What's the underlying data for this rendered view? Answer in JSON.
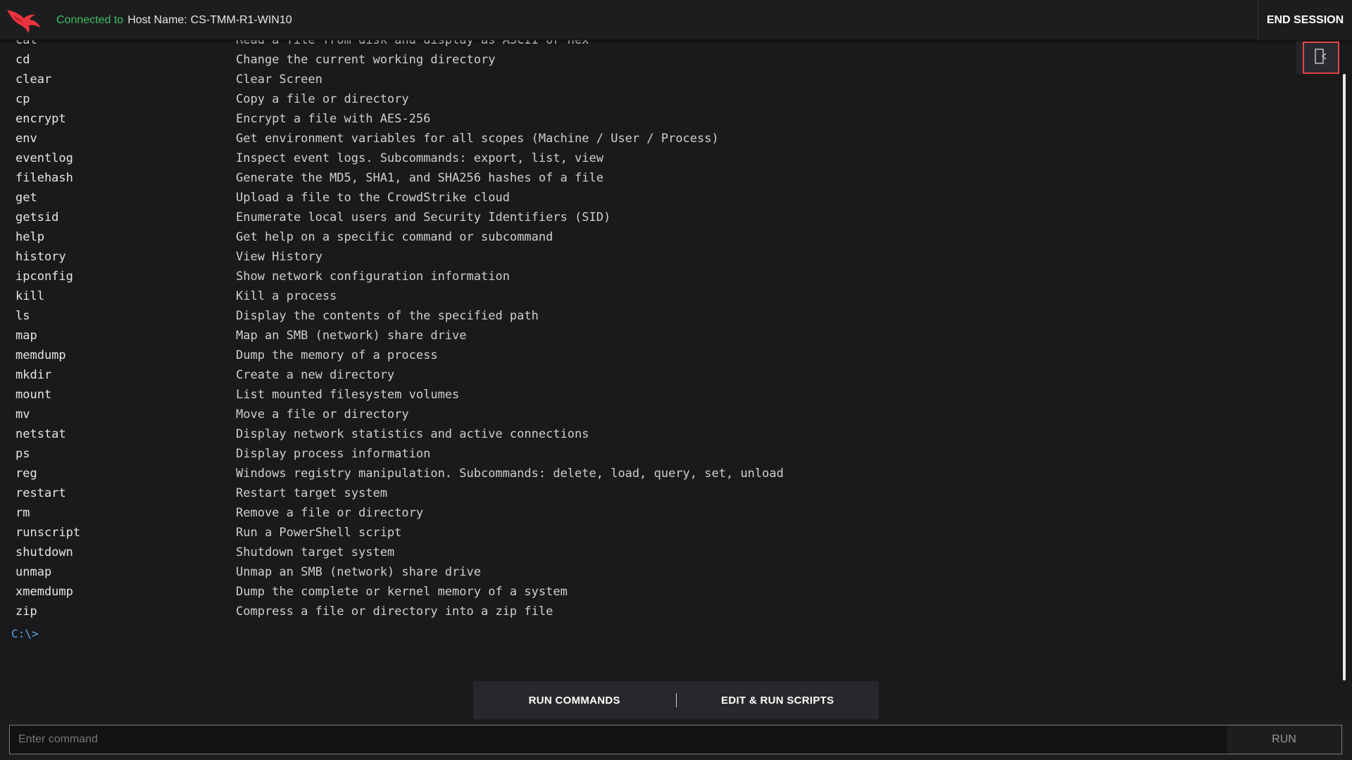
{
  "header": {
    "connected_label": "Connected to",
    "host_label": "Host Name:",
    "host_value": "CS-TMM-R1-WIN10",
    "end_session": "END SESSION"
  },
  "icons": {
    "logo": "falcon-logo-icon",
    "side_panel": "panel-toggle-icon"
  },
  "colors": {
    "connected": "#3fbf5e",
    "prompt": "#5aa6ea",
    "highlight_border": "#e04545"
  },
  "terminal": {
    "commands": [
      {
        "name": "cat",
        "desc": "Read a file from disk and display as ASCII or hex"
      },
      {
        "name": "cd",
        "desc": "Change the current working directory"
      },
      {
        "name": "clear",
        "desc": "Clear Screen"
      },
      {
        "name": "cp",
        "desc": "Copy a file or directory"
      },
      {
        "name": "encrypt",
        "desc": "Encrypt a file with AES-256"
      },
      {
        "name": "env",
        "desc": "Get environment variables for all scopes (Machine / User / Process)"
      },
      {
        "name": "eventlog",
        "desc": "Inspect event logs. Subcommands: export, list, view"
      },
      {
        "name": "filehash",
        "desc": "Generate the MD5, SHA1, and SHA256 hashes of a file"
      },
      {
        "name": "get",
        "desc": "Upload a file to the CrowdStrike cloud"
      },
      {
        "name": "getsid",
        "desc": "Enumerate local users and Security Identifiers (SID)"
      },
      {
        "name": "help",
        "desc": "Get help on a specific command or subcommand"
      },
      {
        "name": "history",
        "desc": "View History"
      },
      {
        "name": "ipconfig",
        "desc": "Show network configuration information"
      },
      {
        "name": "kill",
        "desc": "Kill a process"
      },
      {
        "name": "ls",
        "desc": "Display the contents of the specified path"
      },
      {
        "name": "map",
        "desc": "Map an SMB (network) share drive"
      },
      {
        "name": "memdump",
        "desc": "Dump the memory of a process"
      },
      {
        "name": "mkdir",
        "desc": "Create a new directory"
      },
      {
        "name": "mount",
        "desc": "List mounted filesystem volumes"
      },
      {
        "name": "mv",
        "desc": "Move a file or directory"
      },
      {
        "name": "netstat",
        "desc": "Display network statistics and active connections"
      },
      {
        "name": "ps",
        "desc": "Display process information"
      },
      {
        "name": "reg",
        "desc": "Windows registry manipulation. Subcommands: delete, load, query, set, unload"
      },
      {
        "name": "restart",
        "desc": "Restart target system"
      },
      {
        "name": "rm",
        "desc": "Remove a file or directory"
      },
      {
        "name": "runscript",
        "desc": "Run a PowerShell script"
      },
      {
        "name": "shutdown",
        "desc": "Shutdown target system"
      },
      {
        "name": "unmap",
        "desc": "Unmap an SMB (network) share drive"
      },
      {
        "name": "xmemdump",
        "desc": "Dump the complete or kernel memory of a system"
      },
      {
        "name": "zip",
        "desc": "Compress a file or directory into a zip file"
      }
    ],
    "prompt": "C:\\>"
  },
  "tabs": [
    {
      "label": "RUN COMMANDS"
    },
    {
      "label": "EDIT & RUN SCRIPTS"
    }
  ],
  "command_bar": {
    "placeholder": "Enter command",
    "value": "",
    "run_label": "RUN"
  }
}
